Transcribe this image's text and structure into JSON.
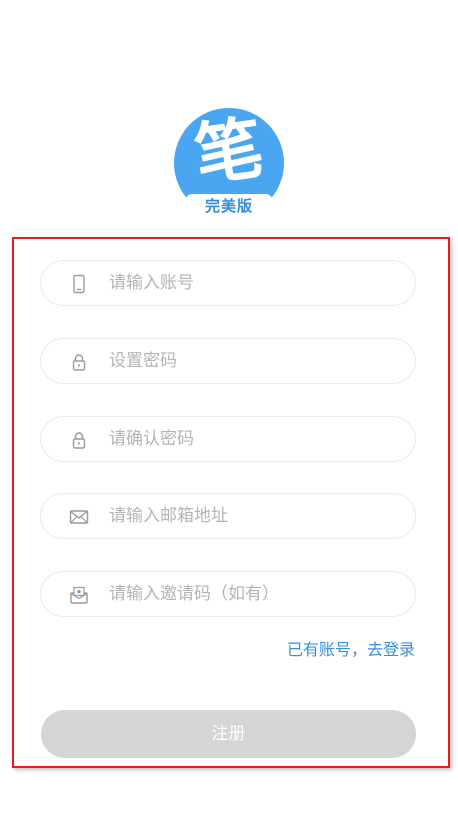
{
  "logo": {
    "char": "笔",
    "subtitle": "完美版"
  },
  "form": {
    "account": {
      "placeholder": "请输入账号",
      "icon": "phone-icon"
    },
    "password": {
      "placeholder": "设置密码",
      "icon": "lock-icon"
    },
    "confirm_password": {
      "placeholder": "请确认密码",
      "icon": "lock-icon"
    },
    "email": {
      "placeholder": "请输入邮箱地址",
      "icon": "mail-icon"
    },
    "invite_code": {
      "placeholder": "请输入邀请码（如有）",
      "icon": "invite-mail-icon"
    }
  },
  "login_link": "已有账号，去登录",
  "register_button": "注册",
  "colors": {
    "brand": "#4aa6f0",
    "link": "#3b8fd8",
    "button_disabled": "#d5d5d5",
    "highlight_frame": "#e01e1e"
  }
}
